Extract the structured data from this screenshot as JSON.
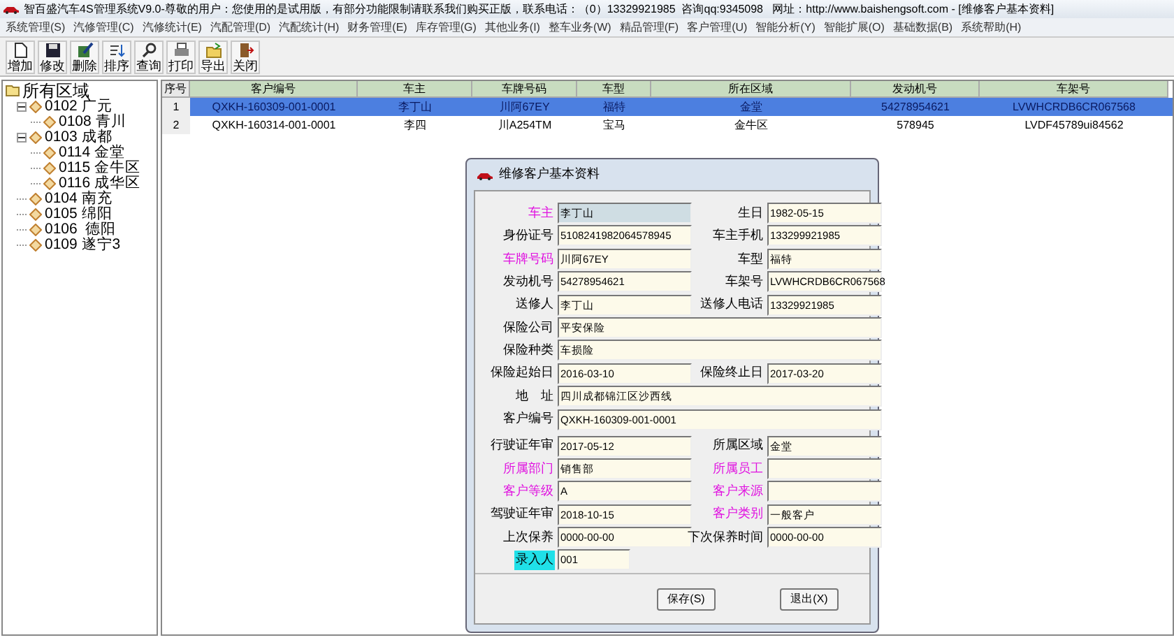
{
  "window": {
    "title": "智百盛汽车4S管理系统V9.0-尊敬的用户：您使用的是试用版，有部分功能限制请联系我们购买正版，联系电话：（0）13329921985  咨询qq:9345098   网址：http://www.baishengsoft.com - [维修客户基本资料]"
  },
  "menu": [
    "系统管理(S)",
    "汽修管理(C)",
    "汽修统计(E)",
    "汽配管理(D)",
    "汽配统计(H)",
    "财务管理(E)",
    "库存管理(G)",
    "其他业务(I)",
    "整车业务(W)",
    "精品管理(F)",
    "客户管理(U)",
    "智能分析(Y)",
    "智能扩展(O)",
    "基础数据(B)",
    "系统帮助(H)"
  ],
  "toolbar": [
    {
      "label": "增加",
      "kind": "new"
    },
    {
      "label": "修改",
      "kind": "save"
    },
    {
      "label": "删除",
      "kind": "edit"
    },
    {
      "label": "排序",
      "kind": "sort"
    },
    {
      "label": "查询",
      "kind": "search"
    },
    {
      "label": "打印",
      "kind": "print"
    },
    {
      "label": "导出",
      "kind": "export"
    },
    {
      "label": "关闭",
      "kind": "close"
    }
  ],
  "tree": {
    "label": "所有区域",
    "children": [
      {
        "label": "0102 广元",
        "expanded": true,
        "children": [
          {
            "label": "0108 青川"
          }
        ]
      },
      {
        "label": "0103 成都",
        "expanded": true,
        "children": [
          {
            "label": "0114 金堂"
          },
          {
            "label": "0115 金牛区"
          },
          {
            "label": "0116 成华区"
          }
        ]
      },
      {
        "label": "0104 南充"
      },
      {
        "label": "0105 绵阳"
      },
      {
        "label": "0106  德阳"
      },
      {
        "label": "0109 遂宁3"
      }
    ]
  },
  "table": {
    "columns": [
      "序号",
      "客户编号",
      "车主",
      "车牌号码",
      "车型",
      "所在区域",
      "发动机号",
      "车架号"
    ],
    "rows": [
      {
        "selected": true,
        "cells": [
          "1",
          "QXKH-160309-001-0001",
          "李丁山",
          "川阿67EY",
          "福特",
          "金堂",
          "54278954621",
          "LVWHCRDB6CR067568"
        ]
      },
      {
        "selected": false,
        "cells": [
          "2",
          "QXKH-160314-001-0001",
          "李四",
          "川A254TM",
          "宝马",
          "金牛区",
          "578945",
          "LVDF45789ui84562"
        ]
      }
    ]
  },
  "dialog": {
    "title": "维修客户基本资料",
    "sections": [
      [
        {
          "kind": "pair",
          "fields": [
            {
              "label": "车主",
              "required": true,
              "highlighted": false,
              "value": "李丁山",
              "focused": true
            },
            {
              "label": "生日",
              "required": false,
              "highlighted": false,
              "value": "1982-05-15",
              "focused": false
            }
          ]
        },
        {
          "kind": "pair",
          "fields": [
            {
              "label": "身份证号",
              "required": false,
              "highlighted": false,
              "value": "5108241982064578945",
              "focused": false
            },
            {
              "label": "车主手机",
              "required": false,
              "highlighted": false,
              "value": "133299921985",
              "focused": false
            }
          ]
        },
        {
          "kind": "pair",
          "fields": [
            {
              "label": "车牌号码",
              "required": true,
              "highlighted": false,
              "value": "川阿67EY",
              "focused": false
            },
            {
              "label": "车型",
              "required": false,
              "highlighted": false,
              "value": "福特",
              "focused": false
            }
          ]
        },
        {
          "kind": "pair",
          "fields": [
            {
              "label": "发动机号",
              "required": false,
              "highlighted": false,
              "value": "54278954621",
              "focused": false
            },
            {
              "label": "车架号",
              "required": false,
              "highlighted": false,
              "value": "LVWHCRDB6CR067568",
              "focused": false
            }
          ]
        },
        {
          "kind": "pair",
          "fields": [
            {
              "label": "送修人",
              "required": false,
              "highlighted": false,
              "value": "李丁山",
              "focused": false
            },
            {
              "label": "送修人电话",
              "required": false,
              "highlighted": false,
              "value": "13329921985",
              "focused": false
            }
          ]
        },
        {
          "kind": "wide",
          "fields": [
            {
              "label": "保险公司",
              "required": false,
              "highlighted": false,
              "value": "平安保险",
              "focused": false
            }
          ]
        },
        {
          "kind": "wide",
          "fields": [
            {
              "label": "保险种类",
              "required": false,
              "highlighted": false,
              "value": "车损险",
              "focused": false
            }
          ]
        },
        {
          "kind": "pair",
          "fields": [
            {
              "label": "保险起始日",
              "required": false,
              "highlighted": false,
              "value": "2016-03-10",
              "focused": false
            },
            {
              "label": "保险终止日",
              "required": false,
              "highlighted": false,
              "value": "2017-03-20",
              "focused": false
            }
          ]
        },
        {
          "kind": "wide",
          "fields": [
            {
              "label": "地　址",
              "required": false,
              "highlighted": false,
              "value": "四川成都锦江区沙西线",
              "focused": false
            }
          ]
        },
        {
          "kind": "wide",
          "fields": [
            {
              "label": "客户编号",
              "required": false,
              "highlighted": false,
              "value": "QXKH-160309-001-0001",
              "focused": false
            }
          ]
        }
      ],
      [
        {
          "kind": "pair",
          "fields": [
            {
              "label": "行驶证年审",
              "required": false,
              "highlighted": false,
              "value": "2017-05-12",
              "focused": false
            },
            {
              "label": "所属区域",
              "required": false,
              "highlighted": false,
              "value": "金堂",
              "focused": false
            }
          ]
        },
        {
          "kind": "pair",
          "fields": [
            {
              "label": "所属部门",
              "required": true,
              "highlighted": false,
              "value": "销售部",
              "focused": false
            },
            {
              "label": "所属员工",
              "required": true,
              "highlighted": false,
              "focused": false
            }
          ]
        },
        {
          "kind": "pair",
          "fields": [
            {
              "label": "客户等级",
              "required": true,
              "highlighted": false,
              "value": "A",
              "focused": false
            },
            {
              "label": "客户来源",
              "required": true,
              "highlighted": false,
              "focused": false
            }
          ]
        },
        {
          "kind": "pair",
          "fields": [
            {
              "label": "驾驶证年审",
              "required": false,
              "highlighted": false,
              "value": "2018-10-15",
              "focused": false
            },
            {
              "label": "客户类别",
              "required": true,
              "highlighted": false,
              "value": "一般客户",
              "focused": false
            }
          ]
        },
        {
          "kind": "pair",
          "fields": [
            {
              "label": "上次保养",
              "required": false,
              "highlighted": false,
              "value": "0000-00-00",
              "focused": false
            },
            {
              "label": "下次保养时间",
              "required": false,
              "highlighted": false,
              "value": "0000-00-00",
              "focused": false
            }
          ]
        },
        {
          "kind": "short",
          "fields": [
            {
              "label": "录入人",
              "required": false,
              "highlighted": true,
              "value": "001",
              "focused": false
            }
          ]
        }
      ]
    ],
    "buttons": [
      "保存(S)",
      "退出(X)"
    ]
  }
}
